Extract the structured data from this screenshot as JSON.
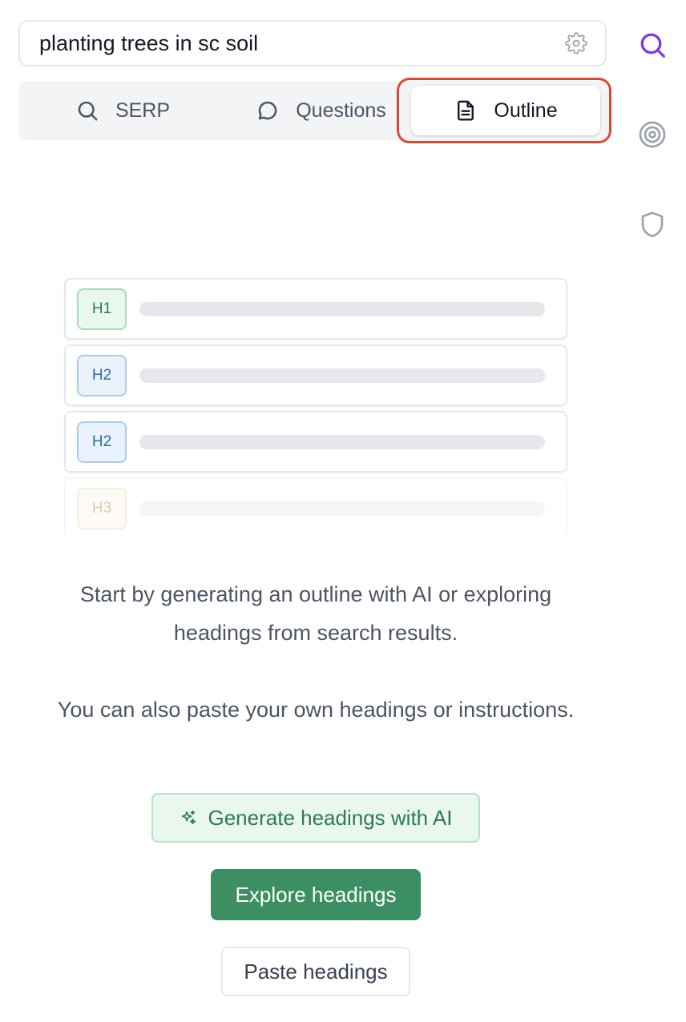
{
  "search": {
    "value": "planting trees in sc soil"
  },
  "tabs": [
    {
      "label": "SERP",
      "icon": "search-icon"
    },
    {
      "label": "Questions",
      "icon": "chat-bubble-icon"
    },
    {
      "label": "Outline",
      "icon": "document-icon",
      "active": true
    }
  ],
  "rail": {
    "items": [
      "search-icon",
      "target-icon",
      "shield-icon"
    ],
    "active_color": "#7c3aed"
  },
  "outline_preview": {
    "rows": [
      {
        "tag": "H1"
      },
      {
        "tag": "H2"
      },
      {
        "tag": "H2"
      },
      {
        "tag": "H3"
      }
    ]
  },
  "empty_state": {
    "line1": "Start by generating an outline with AI or exploring headings from search results.",
    "line2": "You can also paste your own headings or instructions."
  },
  "actions": {
    "generate_label": "Generate headings with AI",
    "explore_label": "Explore headings",
    "paste_label": "Paste headings"
  },
  "colors": {
    "highlight": "#e0472f",
    "primary_green": "#3b8f63"
  }
}
